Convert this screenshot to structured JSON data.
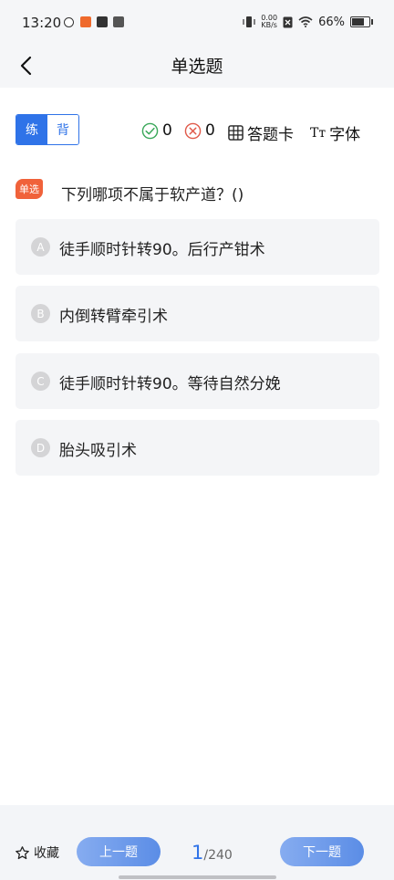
{
  "status_bar": {
    "time": "13:20",
    "net_speed_value": "0.00",
    "net_speed_unit": "KB/s",
    "battery_text": "66%",
    "battery_level": 0.66
  },
  "header": {
    "title": "单选题"
  },
  "toolbar": {
    "modes": [
      "练",
      "背"
    ],
    "active_mode": "练",
    "correct_count": "0",
    "wrong_count": "0",
    "answer_card_label": "答题卡",
    "font_label": "字体",
    "font_icon_text": "Tт"
  },
  "question": {
    "type_tag": "单选",
    "text": "下列哪项不属于软产道？()"
  },
  "options": [
    {
      "letter": "A",
      "text": "徒手顺时针转90。后行产钳术"
    },
    {
      "letter": "B",
      "text": "内倒转臂牵引术"
    },
    {
      "letter": "C",
      "text": "徒手顺时针转90。等待自然分娩"
    },
    {
      "letter": "D",
      "text": "胎头吸引术"
    }
  ],
  "footer": {
    "favorite_label": "收藏",
    "prev_label": "上一题",
    "next_label": "下一题",
    "current_page": "1",
    "total_pages": "/240"
  },
  "colors": {
    "accent": "#2f73e8",
    "tag": "#f0623a",
    "correct": "#3aa85a",
    "wrong": "#e05a4a"
  }
}
